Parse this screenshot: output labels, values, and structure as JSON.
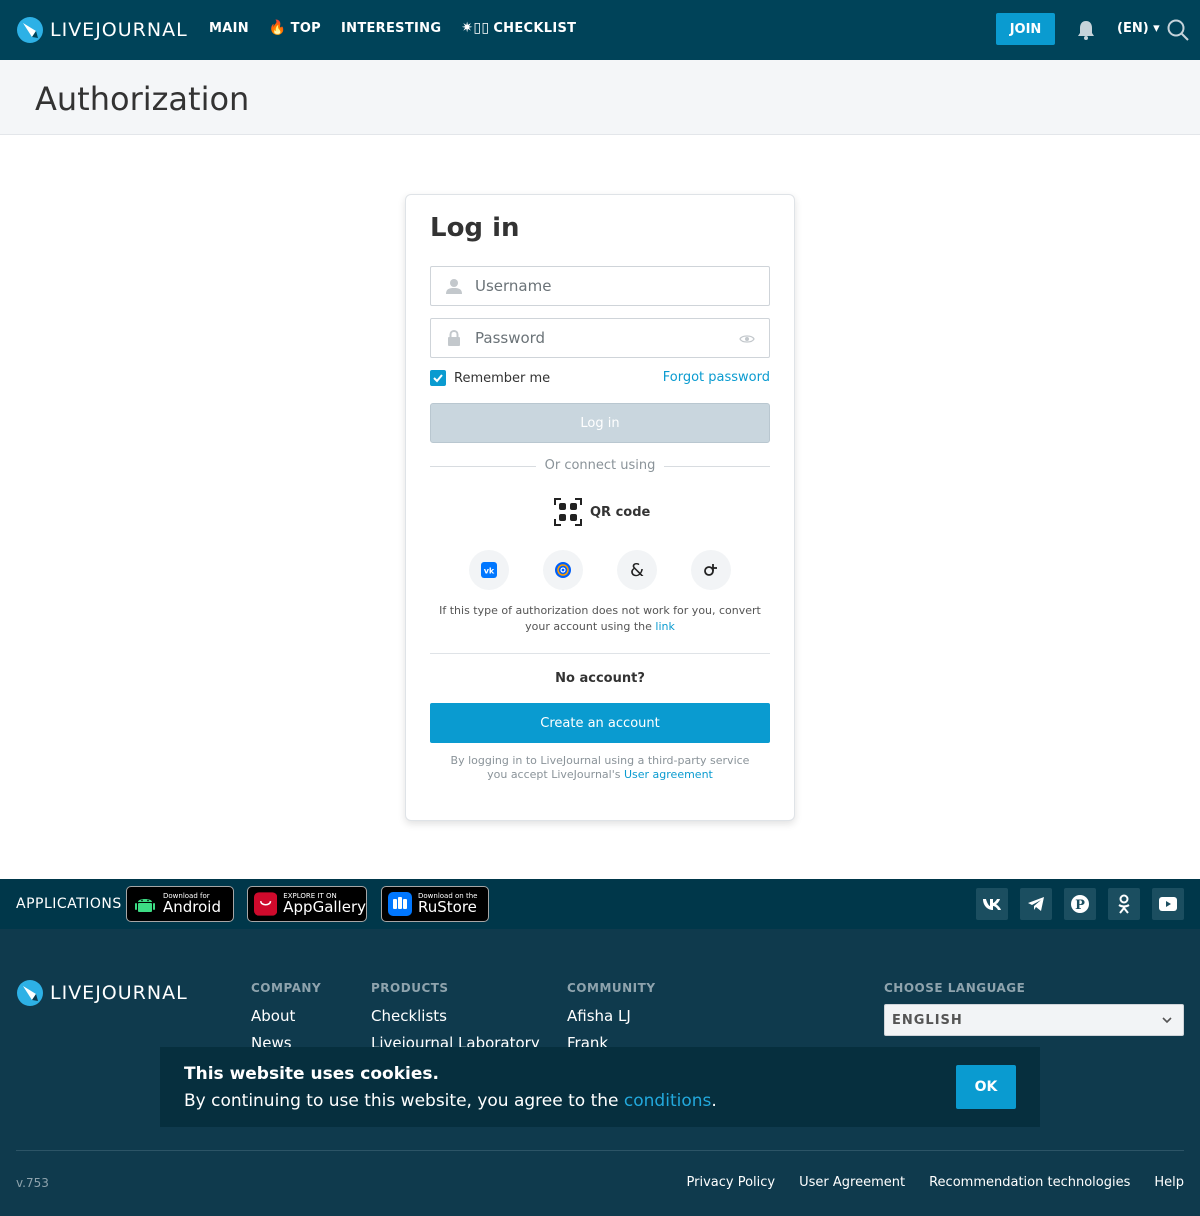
{
  "header": {
    "logo_text": "LIVEJOURNAL",
    "nav": [
      {
        "label": "MAIN",
        "glyph": ""
      },
      {
        "label": "TOP",
        "glyph": "🔥"
      },
      {
        "label": "INTERESTING",
        "glyph": ""
      },
      {
        "label": "CHECKLIST",
        "glyph": "✷▯▯"
      }
    ],
    "join_label": "JOIN",
    "language": "(EN) ▾"
  },
  "page": {
    "title": "Authorization"
  },
  "login": {
    "heading": "Log in",
    "username_placeholder": "Username",
    "password_placeholder": "Password",
    "remember_label": "Remember me",
    "remember_checked": true,
    "forgot_label": "Forgot password",
    "submit_label": "Log in",
    "connect_label": "Or connect using",
    "qr_label": "QR code",
    "social_icons": [
      "vk-icon",
      "mailru-icon",
      "ampersand-icon",
      "odnoklassniki-icon"
    ],
    "note_text": "If this type of authorization does not work for you, convert your account using the ",
    "note_link": "link",
    "no_account": "No account?",
    "create_label": "Create an account",
    "agree_text": "By logging in to LiveJournal using a third-party service you accept LiveJournal's ",
    "agree_link": "User agreement"
  },
  "apps": {
    "label": "APPLICATIONS",
    "stores": [
      {
        "small": "Download for",
        "big": "Android"
      },
      {
        "small": "EXPLORE IT ON",
        "big": "AppGallery"
      },
      {
        "small": "Download on the",
        "big": "RuStore"
      }
    ],
    "socials": [
      "vk-icon",
      "telegram-icon",
      "pinterest-icon",
      "odnoklassniki-icon",
      "youtube-icon"
    ]
  },
  "footer": {
    "logo_text": "LIVEJOURNAL",
    "columns": [
      {
        "title": "COMPANY",
        "links": [
          "About",
          "News"
        ]
      },
      {
        "title": "PRODUCTS",
        "links": [
          "Checklists",
          "Livejournal Laboratory"
        ]
      },
      {
        "title": "COMMUNITY",
        "links": [
          "Afisha LJ",
          "Frank"
        ]
      }
    ],
    "choose_language": "CHOOSE LANGUAGE",
    "language_value": "ENGLISH",
    "version": "v.753",
    "bottom_links": [
      "Privacy Policy",
      "User Agreement",
      "Recommendation technologies",
      "Help"
    ]
  },
  "cookie": {
    "title": "This website uses cookies.",
    "text": "By continuing to use this website, you agree to the ",
    "link": "conditions",
    "tail": ".",
    "ok_label": "OK"
  },
  "colors": {
    "header_bg": "#004359",
    "accent": "#0a9bd0",
    "footer_bg": "#0f3a4d"
  }
}
